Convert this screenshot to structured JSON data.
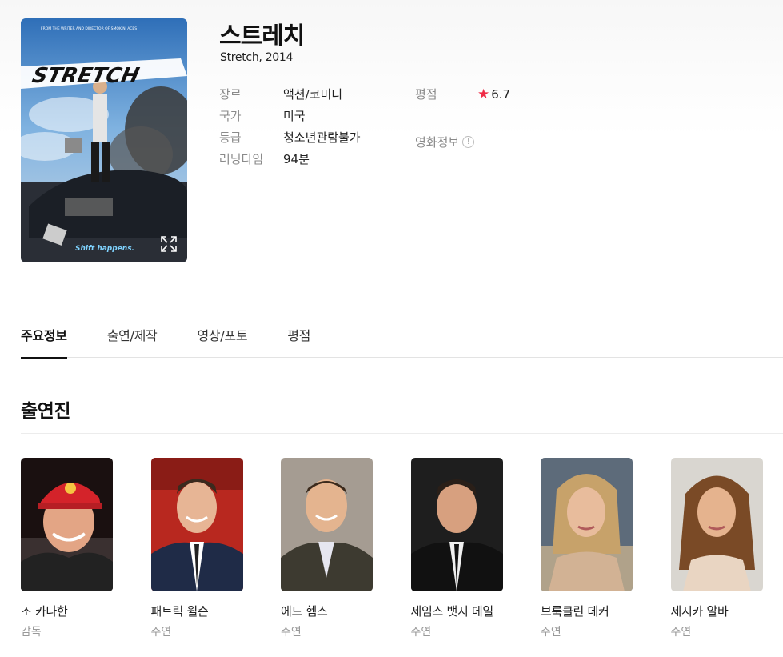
{
  "movie": {
    "title": "스트레치",
    "subtitle": "Stretch, 2014"
  },
  "poster": {
    "tagline": "Shift happens.",
    "logo_text": "STRETCH",
    "top_text": "FROM THE WRITER AND DIRECTOR OF SMOKIN' ACES",
    "expand_icon": "expand-icon"
  },
  "info": [
    {
      "label": "장르",
      "value": "액션/코미디"
    },
    {
      "label": "국가",
      "value": "미국"
    },
    {
      "label": "등급",
      "value": "청소년관람불가"
    },
    {
      "label": "러닝타임",
      "value": "94분"
    }
  ],
  "rating": {
    "label": "평점",
    "value": "6.7",
    "star_color": "#ef2b46"
  },
  "movie_info_link": {
    "label": "영화정보",
    "icon": "info-circle-icon"
  },
  "tabs": [
    {
      "label": "주요정보",
      "active": true
    },
    {
      "label": "출연/제작",
      "active": false
    },
    {
      "label": "영상/포토",
      "active": false
    },
    {
      "label": "평점",
      "active": false
    }
  ],
  "cast_section": {
    "title": "출연진"
  },
  "cast": [
    {
      "name": "조 카나한",
      "role": "감독"
    },
    {
      "name": "패트릭 윌슨",
      "role": "주연"
    },
    {
      "name": "에드 헴스",
      "role": "주연"
    },
    {
      "name": "제임스 뱃지 데일",
      "role": "주연"
    },
    {
      "name": "브룩클린 데커",
      "role": "주연"
    },
    {
      "name": "제시카 알바",
      "role": "주연"
    }
  ]
}
